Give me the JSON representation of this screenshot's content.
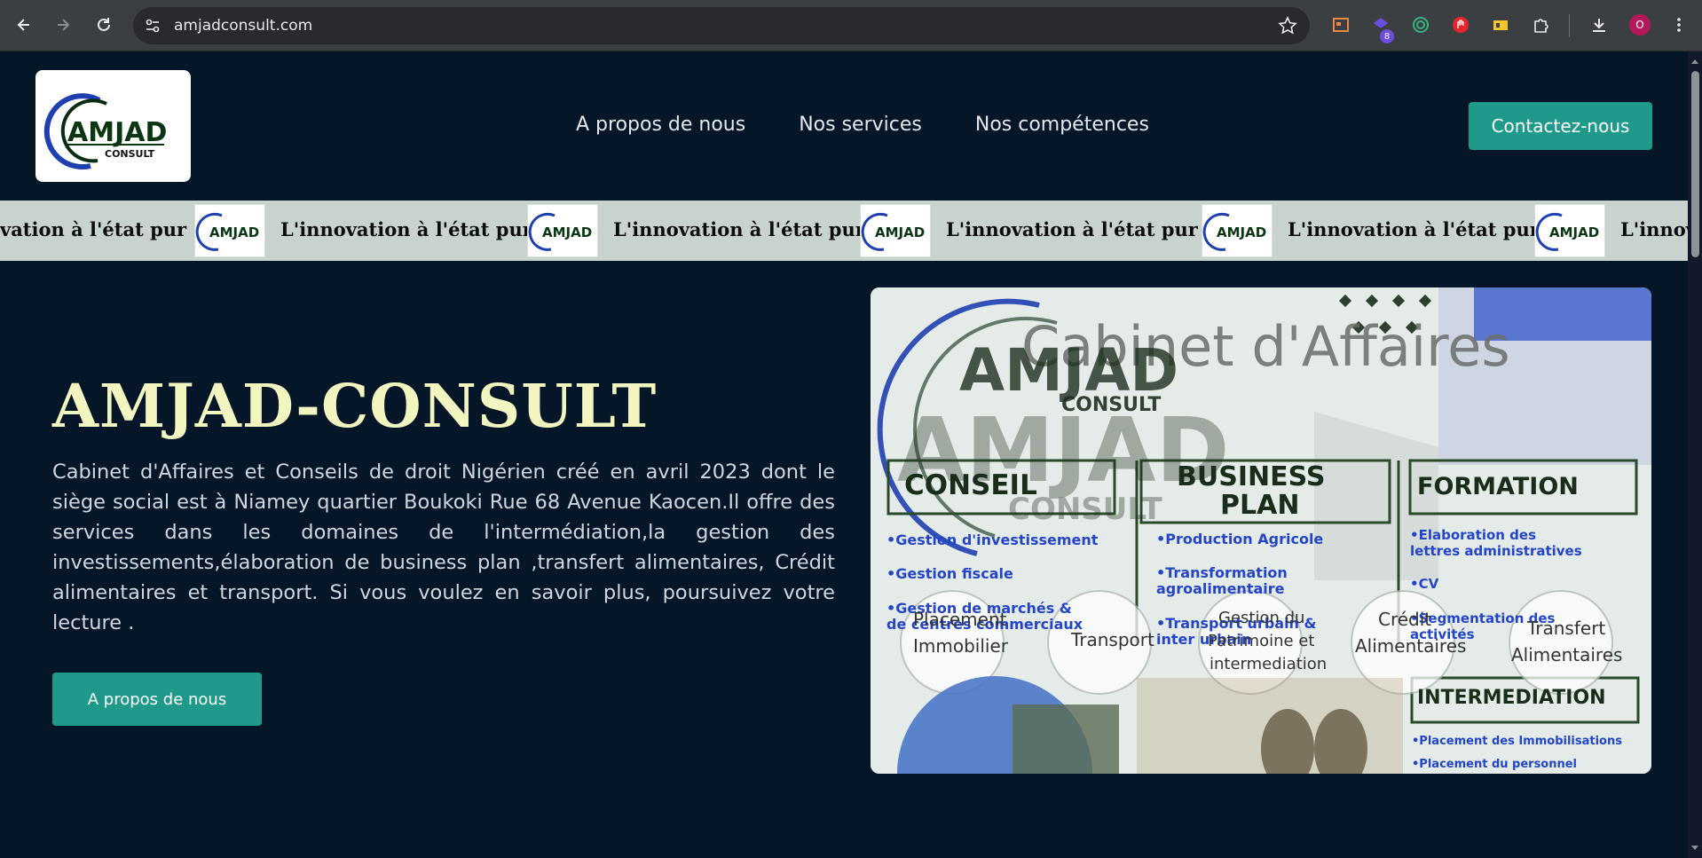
{
  "browser": {
    "url": "amjadconsult.com",
    "extension_badge": "8",
    "profile_initial": "O",
    "icons": [
      "back-icon",
      "forward-icon",
      "reload-icon",
      "site-settings-icon",
      "bookmark-star-icon",
      "extension-icon",
      "downloads-icon",
      "profile-avatar"
    ]
  },
  "header": {
    "logo": {
      "main": "AMJAD",
      "sub": "CONSULT"
    },
    "nav": [
      "A propos de nous",
      "Nos services",
      "Nos compétences"
    ],
    "contact_label": "Contactez-nous"
  },
  "marquee": {
    "text": "L'innovation à l'état pur",
    "partial_start": "vation à l'état pur",
    "partial_end": "L'innov"
  },
  "hero": {
    "title": "AMJAD-CONSULT",
    "description": "Cabinet d'Affaires et Conseils de droit Nigérien créé en avril 2023 dont le siège social est à Niamey quartier Boukoki Rue 68 Avenue Kaocen.Il offre des services dans les domaines de l'intermédiation,la gestion des investissements,élaboration de business plan ,transfert alimentaires, Crédit alimentaires et transport. Si vous voulez en savoir plus, poursuivez votre lecture .",
    "button_label": "A propos de nous"
  },
  "hero_image": {
    "headline": "Cabinet d'Affaires",
    "brand": "AMJAD",
    "brand_sub": "CONSULT",
    "columns": [
      {
        "title": "CONSEIL",
        "items": [
          "•Gestion d'investissement",
          "•Gestion fiscale",
          "•Gestion de marchés &",
          "de centres commerciaux"
        ]
      },
      {
        "title_l1": "BUSINESS",
        "title_l2": "PLAN",
        "items": [
          "•Production Agricole",
          "•Transformation",
          "agroalimentaire",
          "•Transport urbain &",
          "inter urbain"
        ]
      },
      {
        "title": "FORMATION",
        "items": [
          "•Elaboration des",
          "lettres administratives",
          "•CV",
          "•Segmentation des",
          "activités"
        ]
      }
    ],
    "intermediation": "INTERMEDIATION",
    "inter_items": [
      "•Placement des Immobilisations",
      "•Placement du personnel"
    ],
    "circles": [
      "Placement",
      "Immobilier",
      "Transport",
      "Gestion du",
      "Patrimoine et",
      "intermediation",
      "Crédit",
      "Alimentaires",
      "Transfert",
      "Alimentaires"
    ]
  },
  "colors": {
    "page_bg": "#061629",
    "accent": "#1f9a8a",
    "title": "#f2f5c0",
    "marquee_bg": "#c8d3cd"
  }
}
